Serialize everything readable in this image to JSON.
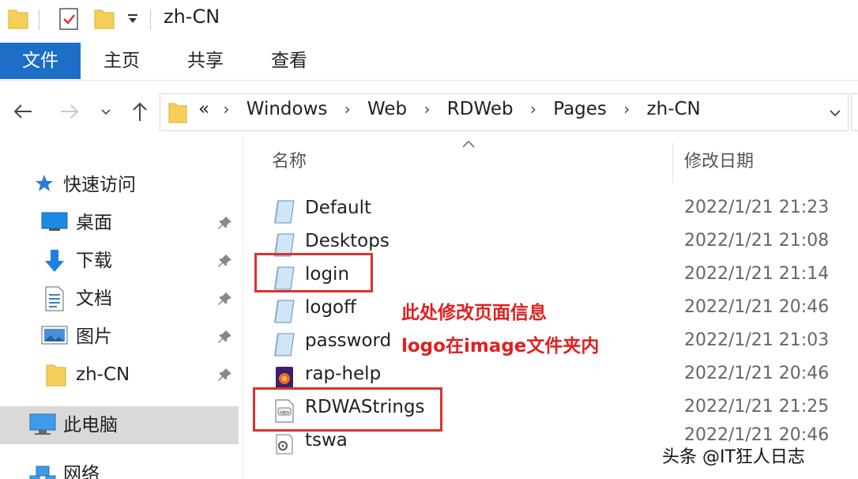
{
  "window": {
    "title": "zh-CN"
  },
  "ribbon": {
    "tabs": [
      "文件",
      "主页",
      "共享",
      "查看"
    ],
    "active_tab": "文件"
  },
  "address": {
    "overflow": "«",
    "breadcrumbs": [
      "Windows",
      "Web",
      "RDWeb",
      "Pages",
      "zh-CN"
    ]
  },
  "navpane": {
    "quick_access": "快速访问",
    "items": [
      {
        "label": "桌面",
        "icon": "desktop-icon",
        "pinned": true
      },
      {
        "label": "下载",
        "icon": "download-icon",
        "pinned": true
      },
      {
        "label": "文档",
        "icon": "document-icon",
        "pinned": true
      },
      {
        "label": "图片",
        "icon": "picture-icon",
        "pinned": true
      },
      {
        "label": "zh-CN",
        "icon": "folder-icon",
        "pinned": true
      }
    ],
    "this_pc": "此电脑",
    "network": "网络"
  },
  "filelist": {
    "columns": {
      "name": "名称",
      "modified": "修改日期"
    },
    "files": [
      {
        "name": "Default",
        "modified": "2022/1/21 21:23",
        "icon": "aspx-file-icon"
      },
      {
        "name": "Desktops",
        "modified": "2022/1/21 21:08",
        "icon": "aspx-file-icon"
      },
      {
        "name": "login",
        "modified": "2022/1/21 21:14",
        "icon": "aspx-file-icon"
      },
      {
        "name": "logoff",
        "modified": "2022/1/21 20:46",
        "icon": "aspx-file-icon"
      },
      {
        "name": "password",
        "modified": "2022/1/21 21:03",
        "icon": "aspx-file-icon"
      },
      {
        "name": "rap-help",
        "modified": "2022/1/21 20:46",
        "icon": "html-file-icon"
      },
      {
        "name": "RDWAStrings",
        "modified": "2022/1/21 21:25",
        "icon": "xml-file-icon"
      },
      {
        "name": "tswa",
        "modified": "2022/1/21 20:46",
        "icon": "script-file-icon"
      }
    ]
  },
  "annotations": {
    "note1": "此处修改页面信息",
    "note2": "logo在image文件夹内"
  },
  "watermark": "头条 @IT狂人日志",
  "colors": {
    "accent": "#1c6ec7",
    "highlight": "#d9342b",
    "note_text": "#e02020",
    "selected_bg": "#d9d9d9"
  }
}
